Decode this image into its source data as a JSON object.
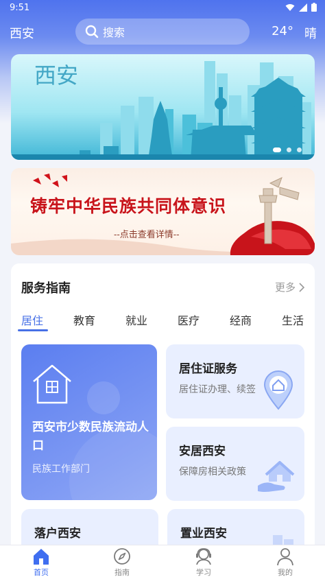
{
  "status": {
    "time": "9:51"
  },
  "header": {
    "city": "西安",
    "search_placeholder": "搜索",
    "temperature": "24°",
    "weather": "晴"
  },
  "banner1": {
    "title": "西安",
    "dots": 3,
    "active_dot": 0
  },
  "banner2": {
    "title": "铸牢中华民族共同体意识",
    "subtitle": "--点击查看详情--"
  },
  "service": {
    "title": "服务指南",
    "more_label": "更多",
    "tabs": [
      {
        "label": "居住",
        "active": true
      },
      {
        "label": "教育"
      },
      {
        "label": "就业"
      },
      {
        "label": "医疗"
      },
      {
        "label": "经商"
      },
      {
        "label": "生活"
      }
    ],
    "featured": {
      "title": "西安市少数民族流动人口",
      "subtitle": "民族工作部门"
    },
    "tiles": [
      {
        "title": "居住证服务",
        "subtitle": "居住证办理、续签",
        "icon": "location-house-icon"
      },
      {
        "title": "安居西安",
        "subtitle": "保障房相关政策",
        "icon": "hand-house-icon"
      },
      {
        "title": "落户西安",
        "subtitle": "",
        "icon": ""
      },
      {
        "title": "置业西安",
        "subtitle": "",
        "icon": ""
      }
    ]
  },
  "bottom_nav": [
    {
      "label": "首页",
      "icon": "home-icon",
      "active": true
    },
    {
      "label": "指南",
      "icon": "compass-icon"
    },
    {
      "label": "学习",
      "icon": "study-icon"
    },
    {
      "label": "我的",
      "icon": "user-icon"
    }
  ],
  "colors": {
    "accent": "#4770e6",
    "header_blue": "#4f73ee",
    "banner_red": "#c8141b"
  }
}
